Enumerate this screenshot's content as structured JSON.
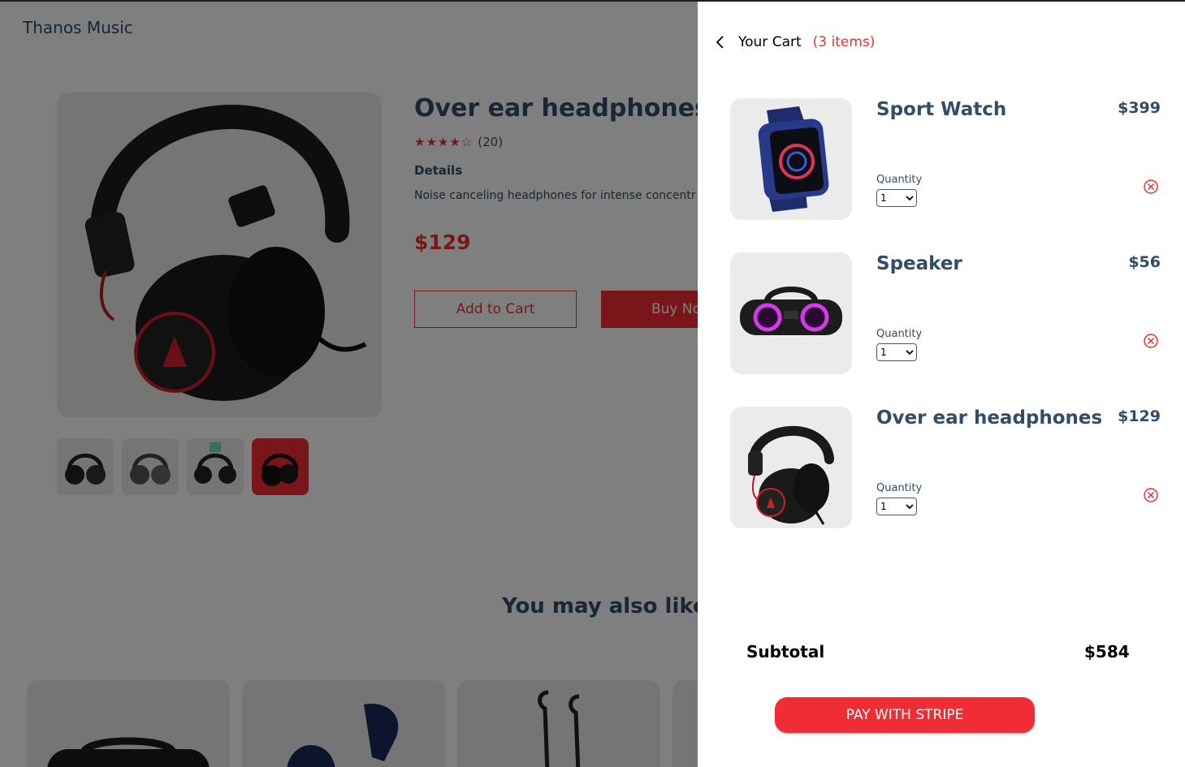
{
  "brand": "Thanos Music",
  "product": {
    "title": "Over ear headphones",
    "stars": "★★★★☆",
    "rating_count": "(20)",
    "details_label": "Details",
    "description": "Noise canceling headphones for intense concentr",
    "price": "$129",
    "add_to_cart": "Add to Cart",
    "buy_now": "Buy No"
  },
  "you_may_also_like": "You may also like",
  "cart": {
    "heading": "Your Cart",
    "count": "(3 items)",
    "quantity_label": "Quantity",
    "items": [
      {
        "name": "Sport Watch",
        "price": "$399",
        "quantity": "1"
      },
      {
        "name": "Speaker",
        "price": "$56",
        "quantity": "1"
      },
      {
        "name": "Over ear headphones",
        "price": "$129",
        "quantity": "1"
      }
    ],
    "subtotal_label": "Subtotal",
    "subtotal_value": "$584",
    "pay_button": "PAY WITH STRIPE"
  },
  "colors": {
    "accent": "#f02d34",
    "text_dark": "#324d67",
    "image_bg": "#ebebeb"
  },
  "icons": {
    "back": "chevron-left-icon",
    "remove": "close-circle-icon",
    "star": "star-icon"
  }
}
